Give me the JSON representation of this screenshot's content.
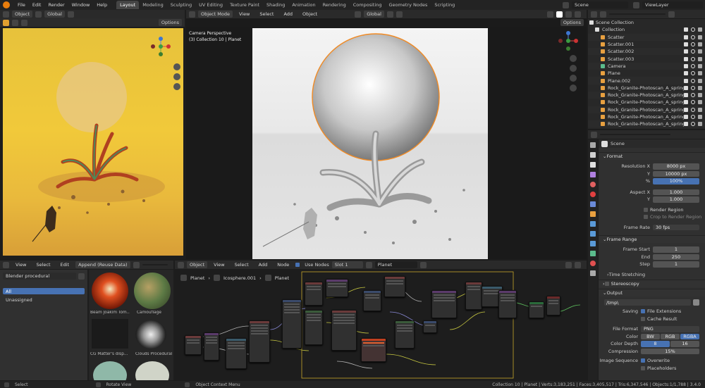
{
  "topbar": {
    "menus": [
      "File",
      "Edit",
      "Render",
      "Window",
      "Help"
    ],
    "workspaces": [
      "Layout",
      "Modeling",
      "Sculpting",
      "UV Editing",
      "Texture Paint",
      "Shading",
      "Animation",
      "Rendering",
      "Compositing",
      "Geometry Nodes",
      "Scripting"
    ],
    "active_workspace": "Layout",
    "scene": "Scene",
    "view_layer": "ViewLayer"
  },
  "left_view": {
    "header": {
      "mode": "Object",
      "transform": "Global",
      "options": "Options"
    }
  },
  "main_view": {
    "header": {
      "mode": "Object Mode",
      "view": "View",
      "select": "Select",
      "add": "Add",
      "object": "Object",
      "transform": "Global",
      "options": "Options"
    },
    "overlay_title": "Camera Perspective",
    "overlay_sub": "(3) Collection 10 | Planet"
  },
  "asset_browser": {
    "menus": [
      "View",
      "Select",
      "Edit"
    ],
    "import_mode": "Append (Reuse Data)",
    "library": "Blender procedural",
    "catalogs": [
      "All",
      "Unassigned"
    ],
    "assets": [
      "Beam Joakim Tom...",
      "Camouflage",
      "CG Matter's disp...",
      "Clouds Procedural ..."
    ]
  },
  "node_editor": {
    "type": "Object",
    "menus": [
      "View",
      "Select",
      "Add",
      "Node"
    ],
    "use_nodes": "Use Nodes",
    "slot": "Slot 1",
    "material": "Planet",
    "breadcrumb": [
      "Planet",
      "Icosphere.001",
      "Planet"
    ]
  },
  "outliner": {
    "root": "Scene Collection",
    "items": [
      {
        "name": "Collection",
        "indent": 1,
        "color": "#dddddd"
      },
      {
        "name": "Scatter",
        "indent": 2,
        "color": "#e8a040"
      },
      {
        "name": "Scatter.001",
        "indent": 2,
        "color": "#e8a040"
      },
      {
        "name": "Scatter.002",
        "indent": 2,
        "color": "#e8a040"
      },
      {
        "name": "Scatter.003",
        "indent": 2,
        "color": "#e8a040"
      },
      {
        "name": "Camera",
        "indent": 2,
        "color": "#5bbc8d"
      },
      {
        "name": "Plane",
        "indent": 2,
        "color": "#e8a040"
      },
      {
        "name": "Plane.002",
        "indent": 2,
        "color": "#e8a040"
      },
      {
        "name": "Rock_Granite-Photoscan_A_spring",
        "indent": 2,
        "color": "#e8a040"
      },
      {
        "name": "Rock_Granite-Photoscan_A_spring",
        "indent": 2,
        "color": "#e8a040"
      },
      {
        "name": "Rock_Granite-Photoscan_A_spring",
        "indent": 2,
        "color": "#e8a040"
      },
      {
        "name": "Rock_Granite-Photoscan_A_spring",
        "indent": 2,
        "color": "#e8a040"
      },
      {
        "name": "Rock_Granite-Photoscan_A_spring",
        "indent": 2,
        "color": "#e8a040"
      },
      {
        "name": "Rock_Granite-Photoscan_A_spring",
        "indent": 2,
        "color": "#e8a040"
      }
    ]
  },
  "properties": {
    "context": "Scene",
    "format_title": "Format",
    "resolution_x_label": "Resolution X",
    "resolution_x": "8000 px",
    "resolution_y_label": "Y",
    "resolution_y": "10000 px",
    "resolution_pct_label": "%",
    "resolution_pct": "100%",
    "aspect_x_label": "Aspect X",
    "aspect_x": "1.000",
    "aspect_y_label": "Y",
    "aspect_y": "1.000",
    "render_region": "Render Region",
    "crop_region": "Crop to Render Region",
    "frame_rate_label": "Frame Rate",
    "frame_rate": "30 fps",
    "frame_range_title": "Frame Range",
    "frame_start_label": "Frame Start",
    "frame_start": "1",
    "frame_end_label": "End",
    "frame_end": "250",
    "frame_step_label": "Step",
    "frame_step": "1",
    "time_stretching": "Time Stretching",
    "stereoscopy": "Stereoscopy",
    "output_title": "Output",
    "output_path": "/tmp\\",
    "saving_label": "Saving",
    "file_extensions": "File Extensions",
    "cache_result": "Cache Result",
    "file_format_label": "File Format",
    "file_format": "PNG",
    "color_label": "Color",
    "color_options": [
      "BW",
      "RGB",
      "RGBA"
    ],
    "color_selected": "RGBA",
    "color_depth_label": "Color Depth",
    "color_depth_options": [
      "8",
      "16"
    ],
    "color_depth_selected": "8",
    "compression_label": "Compression",
    "compression": "15%",
    "image_sequence_label": "Image Sequence",
    "overwrite": "Overwrite",
    "placeholders": "Placeholders"
  },
  "statusbar": {
    "select": "Select",
    "rotate": "Rotate View",
    "context_menu": "Object Context Menu",
    "stats": "Collection 10 | Planet | Verts:3,183,251 | Faces:3,405,517 | Tris:6,347,546 | Objects:1/1,788 | 3.4.0"
  },
  "colors": {
    "accent": "#4772b3",
    "orange": "#e87d0d"
  }
}
